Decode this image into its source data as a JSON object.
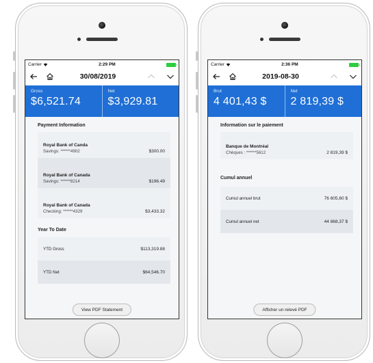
{
  "left": {
    "status": {
      "carrier": "Carrier",
      "time": "2:29 PM"
    },
    "nav": {
      "title": "30/08/2019"
    },
    "summary": {
      "gross_label": "Gross",
      "gross_value": "$6,521.74",
      "net_label": "Net",
      "net_value": "$3,929.81"
    },
    "payment": {
      "title": "Payment Information",
      "items": [
        {
          "bank": "Royal Bank of Canda",
          "account": "Savings: ******4902",
          "amount": "$300.00"
        },
        {
          "bank": "Royal Bank of Canada",
          "account": "Savings: ******8214",
          "amount": "$196.49"
        },
        {
          "bank": "Royal Bank of Canada",
          "account": "Checking: ******4329",
          "amount": "$3,433.32"
        }
      ]
    },
    "ytd": {
      "title": "Year To Date",
      "items": [
        {
          "label": "YTD Gross",
          "amount": "$113,319.88"
        },
        {
          "label": "YTD Net",
          "amount": "$64,546.70"
        }
      ]
    },
    "pdf_button": "View PDF Statement"
  },
  "right": {
    "status": {
      "carrier": "Carrier",
      "time": "2:36 PM"
    },
    "nav": {
      "title": "2019-08-30"
    },
    "summary": {
      "gross_label": "Brut",
      "gross_value": "4 401,43 $",
      "net_label": "Net",
      "net_value": "2 819,39 $"
    },
    "payment": {
      "title": "Information sur le paiement",
      "items": [
        {
          "bank": "Banque de Montréal",
          "account": "Chèques : ******5612",
          "amount": "2 819,39 $"
        }
      ]
    },
    "ytd": {
      "title": "Cumul annuel",
      "items": [
        {
          "label": "Cumul annuel brut",
          "amount": "76 605,60 $"
        },
        {
          "label": "Cumul annuel net",
          "amount": "44 868,37 $"
        }
      ]
    },
    "pdf_button": "Afficher un relevé PDF"
  },
  "icons": [
    "back-arrow-icon",
    "home-icon",
    "chevron-up-icon",
    "chevron-down-icon",
    "wifi-icon",
    "battery-icon"
  ],
  "colors": {
    "accent": "#1f6fd6",
    "battery": "#2ecc40",
    "card": "#eef1f4",
    "card_alt": "#e3e7ec"
  }
}
